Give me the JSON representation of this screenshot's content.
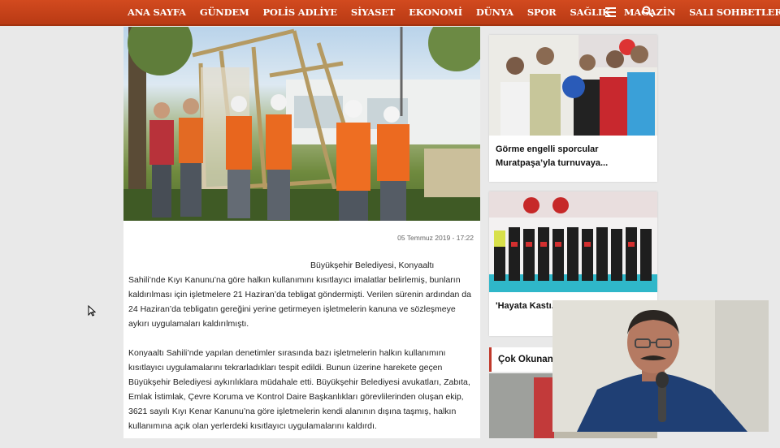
{
  "nav": {
    "items": [
      "ANA SAYFA",
      "GÜNDEM",
      "POLİS ADLİYE",
      "SİYASET",
      "EKONOMİ",
      "DÜNYA",
      "SPOR",
      "SAĞLIK",
      "MAGAZİN",
      "SALI SOHBETLERİ"
    ],
    "menu_icon": "hamburger-menu-icon",
    "search_icon": "search-icon"
  },
  "article": {
    "date": "05 Temmuz 2019 - 17:22",
    "p1_start": "Büyükşehir Belediyesi, Konyaaltı",
    "p1_rest": "Sahili’nde Kıyı Kanunu’na göre halkın kullanımını kısıtlayıcı imalatlar belirlemiş, bunların kaldırılması için işletmelere 21 Haziran’da tebligat göndermişti. Verilen sürenin ardından da 24 Haziran’da tebligatın gereğini yerine getirmeyen işletmelerin kanuna ve sözleşmeye aykırı uygulamaları kaldırılmıştı.",
    "p2": "Konyaaltı Sahili’nde yapılan denetimler sırasında bazı işletmelerin halkın kullanımını kısıtlayıcı uygulamalarını tekrarladıkları tespit edildi. Bunun üzerine harekete geçen Büyükşehir Belediyesi aykırılıklara müdahale etti. Büyükşehir Belediyesi avukatları, Zabıta, Emlak İstimlak, Çevre Koruma ve Kontrol Daire Başkanlıkları görevlilerinden oluşan ekip, 3621 sayılı Kıyı Kenar Kanunu’na göre işletmelerin kendi alanının dışına taşmış, halkın kullanımına açık olan yerlerdeki kısıtlayıcı uygulamalarını kaldırdı."
  },
  "sidebar": {
    "card1_title": "Görme engelli sporcular Muratpaşa’yla turnuvaya...",
    "card2_title": "'Hayata Kastı... tanıtıldı",
    "section_title": "Çok Okunan"
  },
  "colors": {
    "nav_bg": "#c4421a",
    "accent": "#c0392b"
  }
}
